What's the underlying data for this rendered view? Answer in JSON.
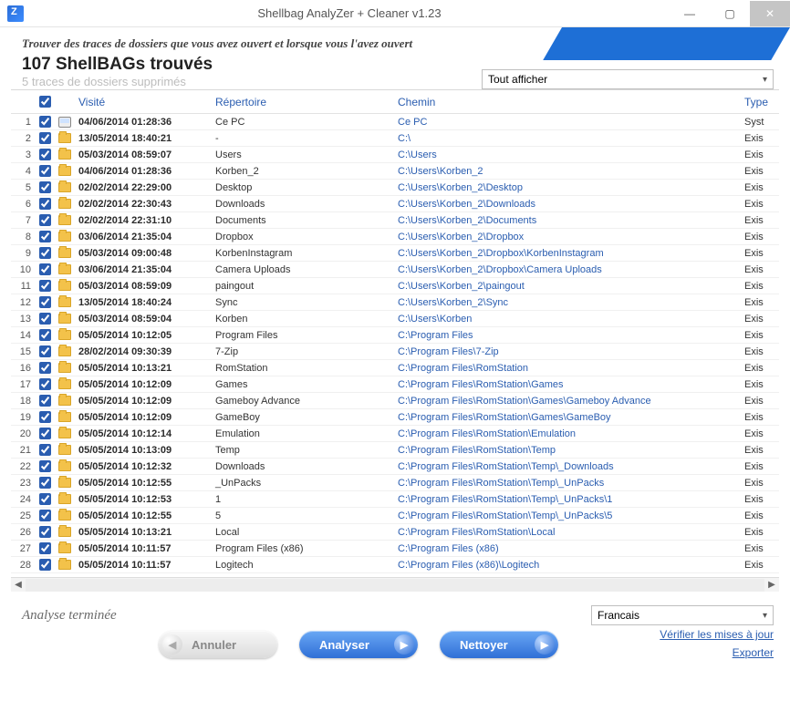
{
  "window": {
    "title": "Shellbag AnalyZer + Cleaner v1.23"
  },
  "banner": {
    "tagline": "Trouver des traces de dossiers que vous avez ouvert et lorsque vous l'avez ouvert",
    "found": "107 ShellBAGs trouvés",
    "sub": "5 traces de dossiers supprimés"
  },
  "filter": {
    "selected": "Tout afficher"
  },
  "columns": {
    "visite": "Visité",
    "repertoire": "Répertoire",
    "chemin": "Chemin",
    "type": "Type"
  },
  "rows": [
    {
      "n": 1,
      "chk": true,
      "icon": "computer",
      "visite": "04/06/2014 01:28:36",
      "rep": "Ce PC",
      "chemin": "Ce PC",
      "type": "Syst"
    },
    {
      "n": 2,
      "chk": true,
      "icon": "folder",
      "visite": "13/05/2014 18:40:21",
      "rep": "-",
      "chemin": "C:\\",
      "type": "Exis"
    },
    {
      "n": 3,
      "chk": true,
      "icon": "folder",
      "visite": "05/03/2014 08:59:07",
      "rep": "Users",
      "chemin": "C:\\Users",
      "type": "Exis"
    },
    {
      "n": 4,
      "chk": true,
      "icon": "folder",
      "visite": "04/06/2014 01:28:36",
      "rep": "Korben_2",
      "chemin": "C:\\Users\\Korben_2",
      "type": "Exis"
    },
    {
      "n": 5,
      "chk": true,
      "icon": "folder",
      "visite": "02/02/2014 22:29:00",
      "rep": "Desktop",
      "chemin": "C:\\Users\\Korben_2\\Desktop",
      "type": "Exis"
    },
    {
      "n": 6,
      "chk": true,
      "icon": "folder",
      "visite": "02/02/2014 22:30:43",
      "rep": "Downloads",
      "chemin": "C:\\Users\\Korben_2\\Downloads",
      "type": "Exis"
    },
    {
      "n": 7,
      "chk": true,
      "icon": "folder",
      "visite": "02/02/2014 22:31:10",
      "rep": "Documents",
      "chemin": "C:\\Users\\Korben_2\\Documents",
      "type": "Exis"
    },
    {
      "n": 8,
      "chk": true,
      "icon": "folder",
      "visite": "03/06/2014 21:35:04",
      "rep": "Dropbox",
      "chemin": "C:\\Users\\Korben_2\\Dropbox",
      "type": "Exis"
    },
    {
      "n": 9,
      "chk": true,
      "icon": "folder",
      "visite": "05/03/2014 09:00:48",
      "rep": "KorbenInstagram",
      "chemin": "C:\\Users\\Korben_2\\Dropbox\\KorbenInstagram",
      "type": "Exis"
    },
    {
      "n": 10,
      "chk": true,
      "icon": "folder",
      "visite": "03/06/2014 21:35:04",
      "rep": "Camera Uploads",
      "chemin": "C:\\Users\\Korben_2\\Dropbox\\Camera Uploads",
      "type": "Exis"
    },
    {
      "n": 11,
      "chk": true,
      "icon": "folder",
      "visite": "05/03/2014 08:59:09",
      "rep": "paingout",
      "chemin": "C:\\Users\\Korben_2\\paingout",
      "type": "Exis"
    },
    {
      "n": 12,
      "chk": true,
      "icon": "folder",
      "visite": "13/05/2014 18:40:24",
      "rep": "Sync",
      "chemin": "C:\\Users\\Korben_2\\Sync",
      "type": "Exis"
    },
    {
      "n": 13,
      "chk": true,
      "icon": "folder",
      "visite": "05/03/2014 08:59:04",
      "rep": "Korben",
      "chemin": "C:\\Users\\Korben",
      "type": "Exis"
    },
    {
      "n": 14,
      "chk": true,
      "icon": "folder",
      "visite": "05/05/2014 10:12:05",
      "rep": "Program Files",
      "chemin": "C:\\Program Files",
      "type": "Exis"
    },
    {
      "n": 15,
      "chk": true,
      "icon": "folder",
      "visite": "28/02/2014 09:30:39",
      "rep": "7-Zip",
      "chemin": "C:\\Program Files\\7-Zip",
      "type": "Exis"
    },
    {
      "n": 16,
      "chk": true,
      "icon": "folder",
      "visite": "05/05/2014 10:13:21",
      "rep": "RomStation",
      "chemin": "C:\\Program Files\\RomStation",
      "type": "Exis"
    },
    {
      "n": 17,
      "chk": true,
      "icon": "folder",
      "visite": "05/05/2014 10:12:09",
      "rep": "Games",
      "chemin": "C:\\Program Files\\RomStation\\Games",
      "type": "Exis"
    },
    {
      "n": 18,
      "chk": true,
      "icon": "folder",
      "visite": "05/05/2014 10:12:09",
      "rep": "Gameboy Advance",
      "chemin": "C:\\Program Files\\RomStation\\Games\\Gameboy Advance",
      "type": "Exis"
    },
    {
      "n": 19,
      "chk": true,
      "icon": "folder",
      "visite": "05/05/2014 10:12:09",
      "rep": "GameBoy",
      "chemin": "C:\\Program Files\\RomStation\\Games\\GameBoy",
      "type": "Exis"
    },
    {
      "n": 20,
      "chk": true,
      "icon": "folder",
      "visite": "05/05/2014 10:12:14",
      "rep": "Emulation",
      "chemin": "C:\\Program Files\\RomStation\\Emulation",
      "type": "Exis"
    },
    {
      "n": 21,
      "chk": true,
      "icon": "folder",
      "visite": "05/05/2014 10:13:09",
      "rep": "Temp",
      "chemin": "C:\\Program Files\\RomStation\\Temp",
      "type": "Exis"
    },
    {
      "n": 22,
      "chk": true,
      "icon": "folder",
      "visite": "05/05/2014 10:12:32",
      "rep": "Downloads",
      "chemin": "C:\\Program Files\\RomStation\\Temp\\_Downloads",
      "type": "Exis"
    },
    {
      "n": 23,
      "chk": true,
      "icon": "folder",
      "visite": "05/05/2014 10:12:55",
      "rep": "_UnPacks",
      "chemin": "C:\\Program Files\\RomStation\\Temp\\_UnPacks",
      "type": "Exis"
    },
    {
      "n": 24,
      "chk": true,
      "icon": "folder",
      "visite": "05/05/2014 10:12:53",
      "rep": "1",
      "chemin": "C:\\Program Files\\RomStation\\Temp\\_UnPacks\\1",
      "type": "Exis"
    },
    {
      "n": 25,
      "chk": true,
      "icon": "folder",
      "visite": "05/05/2014 10:12:55",
      "rep": "5",
      "chemin": "C:\\Program Files\\RomStation\\Temp\\_UnPacks\\5",
      "type": "Exis"
    },
    {
      "n": 26,
      "chk": true,
      "icon": "folder",
      "visite": "05/05/2014 10:13:21",
      "rep": "Local",
      "chemin": "C:\\Program Files\\RomStation\\Local",
      "type": "Exis"
    },
    {
      "n": 27,
      "chk": true,
      "icon": "folder",
      "visite": "05/05/2014 10:11:57",
      "rep": "Program Files (x86)",
      "chemin": "C:\\Program Files (x86)",
      "type": "Exis"
    },
    {
      "n": 28,
      "chk": true,
      "icon": "folder",
      "visite": "05/05/2014 10:11:57",
      "rep": "Logitech",
      "chemin": "C:\\Program Files (x86)\\Logitech",
      "type": "Exis"
    }
  ],
  "footer": {
    "status": "Analyse terminée",
    "lang": "Francais",
    "cancel": "Annuler",
    "analyze": "Analyser",
    "clean": "Nettoyer",
    "updates": "Vérifier les mises à jour",
    "export": "Exporter"
  }
}
